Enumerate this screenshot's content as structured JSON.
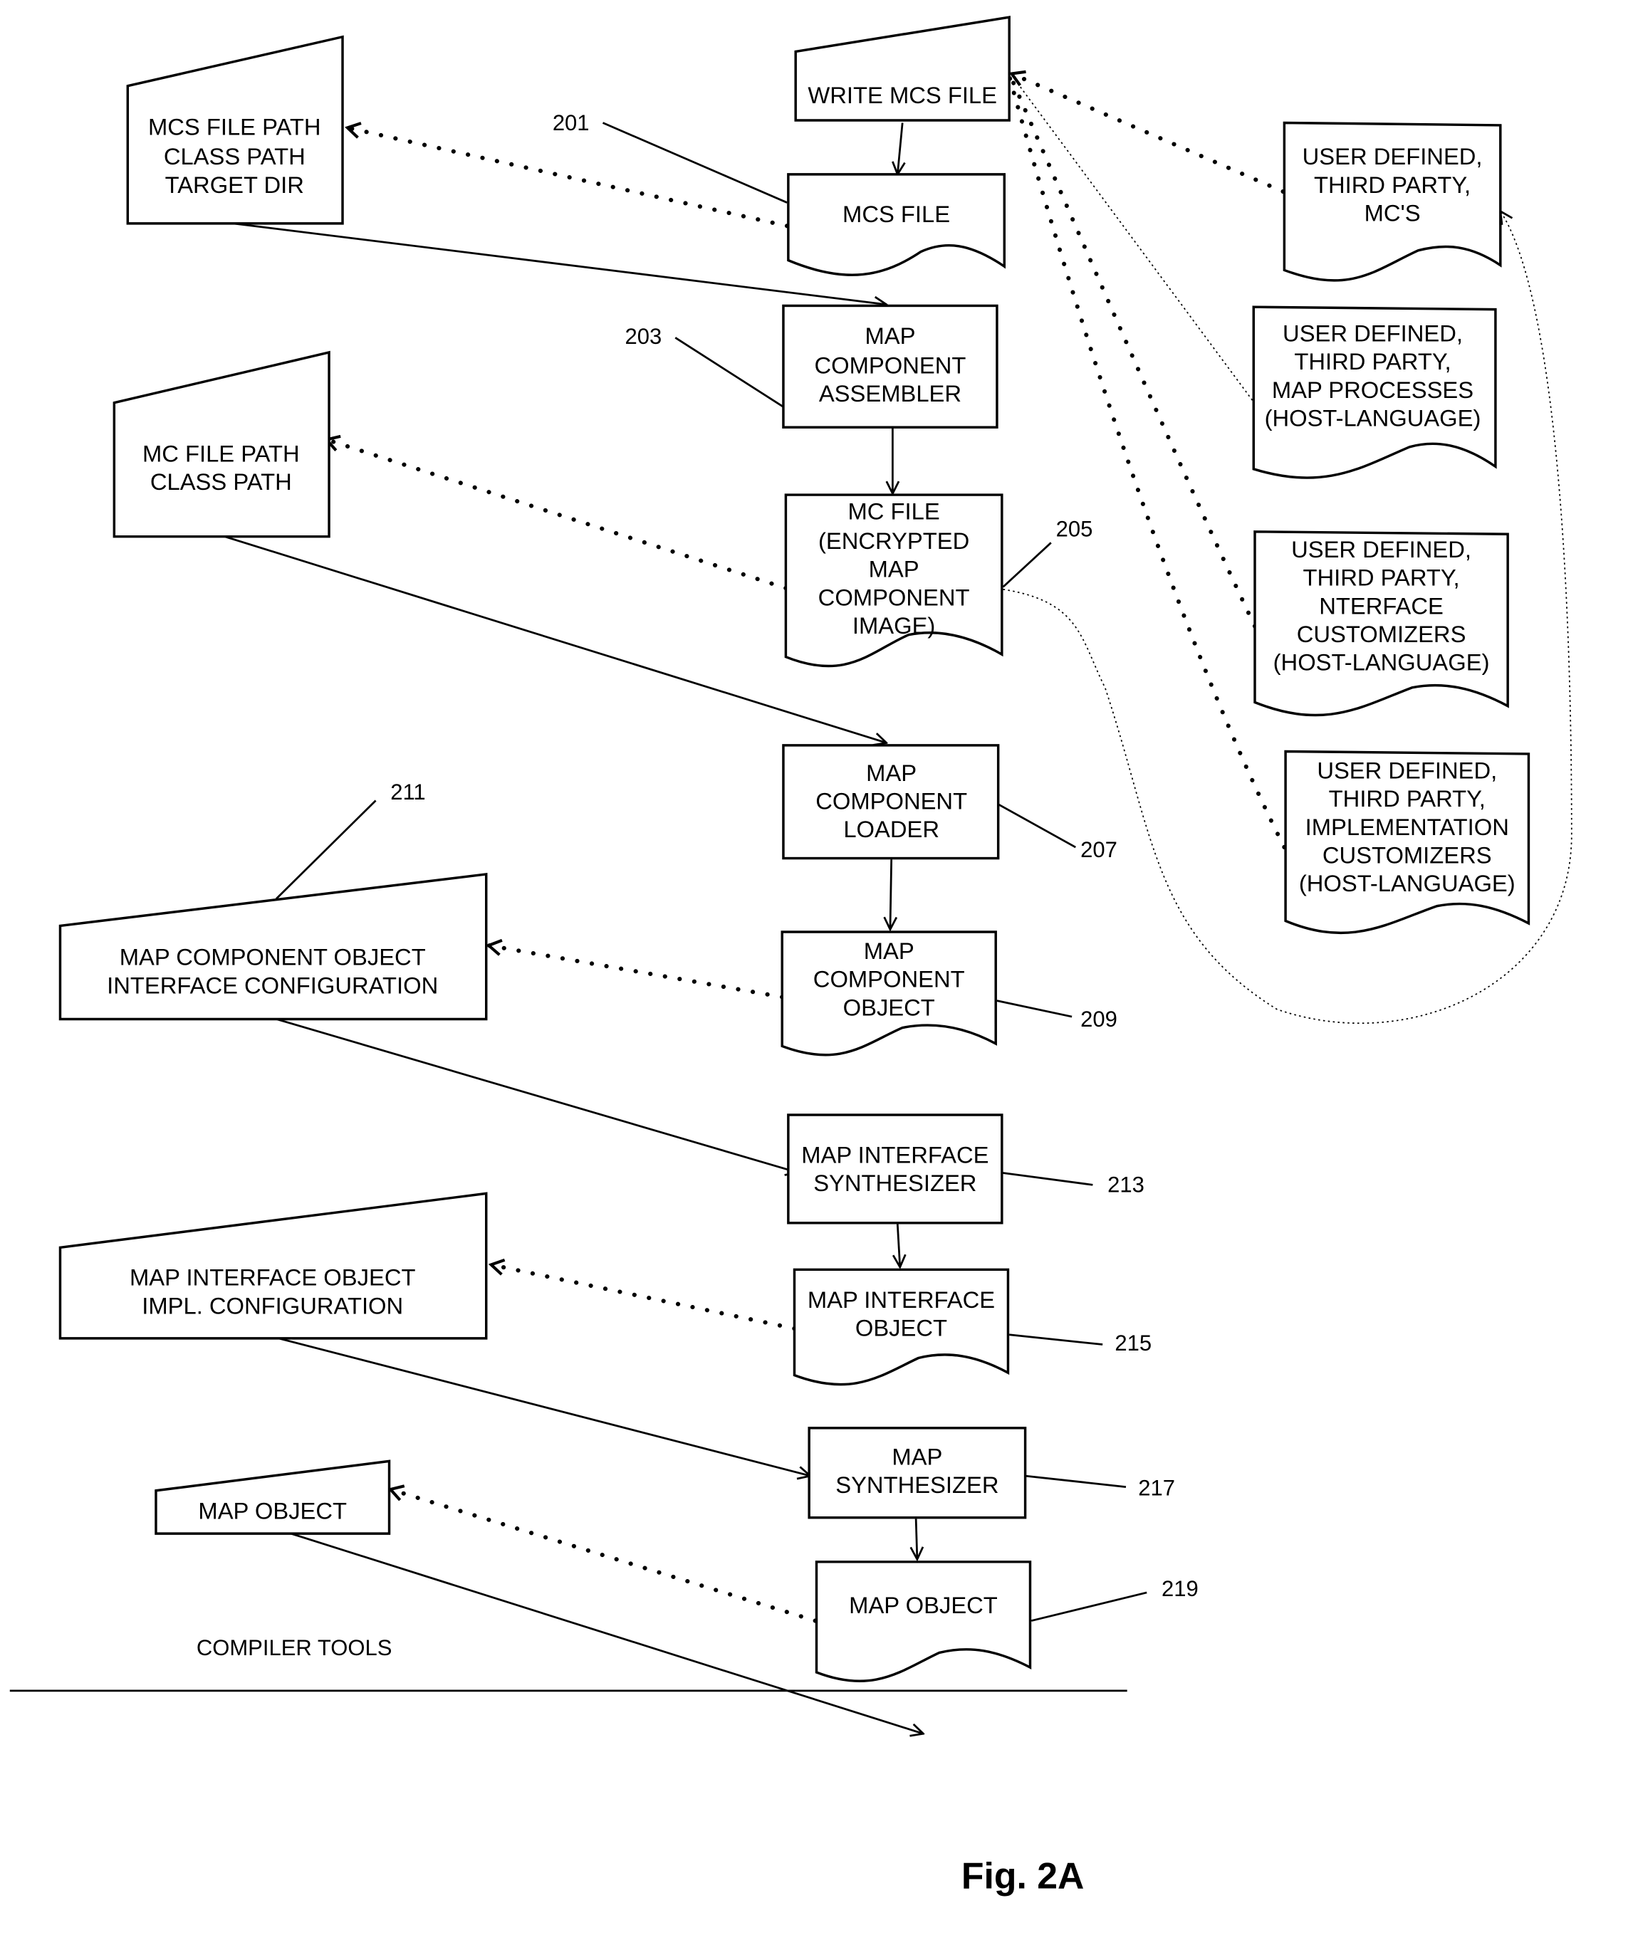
{
  "figure": {
    "caption": "Fig. 2A",
    "section_label": "COMPILER TOOLS"
  },
  "nodes": {
    "write_mcs_file": {
      "lines": [
        "WRITE MCS FILE"
      ],
      "kind": "manual-input"
    },
    "mcs_config": {
      "lines": [
        "MCS FILE PATH",
        "CLASS PATH",
        "TARGET DIR"
      ],
      "kind": "manual-input"
    },
    "mcs_file": {
      "lines": [
        "MCS FILE"
      ],
      "kind": "document",
      "ref": "201"
    },
    "assembler": {
      "lines": [
        "MAP",
        "COMPONENT",
        "ASSEMBLER"
      ],
      "kind": "process",
      "ref": "203"
    },
    "mc_config": {
      "lines": [
        "MC FILE PATH",
        "CLASS PATH"
      ],
      "kind": "manual-input"
    },
    "mc_file": {
      "lines": [
        "MC FILE",
        "(ENCRYPTED",
        "MAP",
        "COMPONENT",
        "IMAGE)"
      ],
      "kind": "document",
      "ref": "205"
    },
    "loader": {
      "lines": [
        "MAP",
        "COMPONENT",
        "LOADER"
      ],
      "kind": "process",
      "ref": "207"
    },
    "mco_config": {
      "lines": [
        "MAP COMPONENT OBJECT",
        "INTERFACE CONFIGURATION"
      ],
      "kind": "manual-input",
      "ref": "211"
    },
    "mc_object": {
      "lines": [
        "MAP",
        "COMPONENT",
        "OBJECT"
      ],
      "kind": "document",
      "ref": "209"
    },
    "interface_synth": {
      "lines": [
        "MAP INTERFACE",
        "SYNTHESIZER"
      ],
      "kind": "process",
      "ref": "213"
    },
    "mio_config": {
      "lines": [
        "MAP INTERFACE OBJECT",
        "IMPL.  CONFIGURATION"
      ],
      "kind": "manual-input"
    },
    "interface_object": {
      "lines": [
        "MAP INTERFACE",
        "OBJECT"
      ],
      "kind": "document",
      "ref": "215"
    },
    "map_synth": {
      "lines": [
        "MAP",
        "SYNTHESIZER"
      ],
      "kind": "process",
      "ref": "217"
    },
    "map_object_input": {
      "lines": [
        "MAP OBJECT"
      ],
      "kind": "manual-input"
    },
    "map_object": {
      "lines": [
        "MAP OBJECT"
      ],
      "kind": "document",
      "ref": "219"
    },
    "ud_mcs": {
      "lines": [
        "USER DEFINED,",
        "THIRD PARTY,",
        "MC'S"
      ],
      "kind": "document"
    },
    "ud_processes": {
      "lines": [
        "USER DEFINED,",
        "THIRD PARTY,",
        "MAP PROCESSES",
        "(HOST-LANGUAGE)"
      ],
      "kind": "document"
    },
    "ud_interface": {
      "lines": [
        "USER DEFINED,",
        "THIRD PARTY,",
        "NTERFACE",
        "CUSTOMIZERS",
        "(HOST-LANGUAGE)"
      ],
      "kind": "document"
    },
    "ud_impl": {
      "lines": [
        "USER DEFINED,",
        "THIRD PARTY,",
        "IMPLEMENTATION",
        "CUSTOMIZERS",
        "(HOST-LANGUAGE)"
      ],
      "kind": "document"
    }
  },
  "colors": {
    "ink": "#000000",
    "paper": "#ffffff"
  }
}
